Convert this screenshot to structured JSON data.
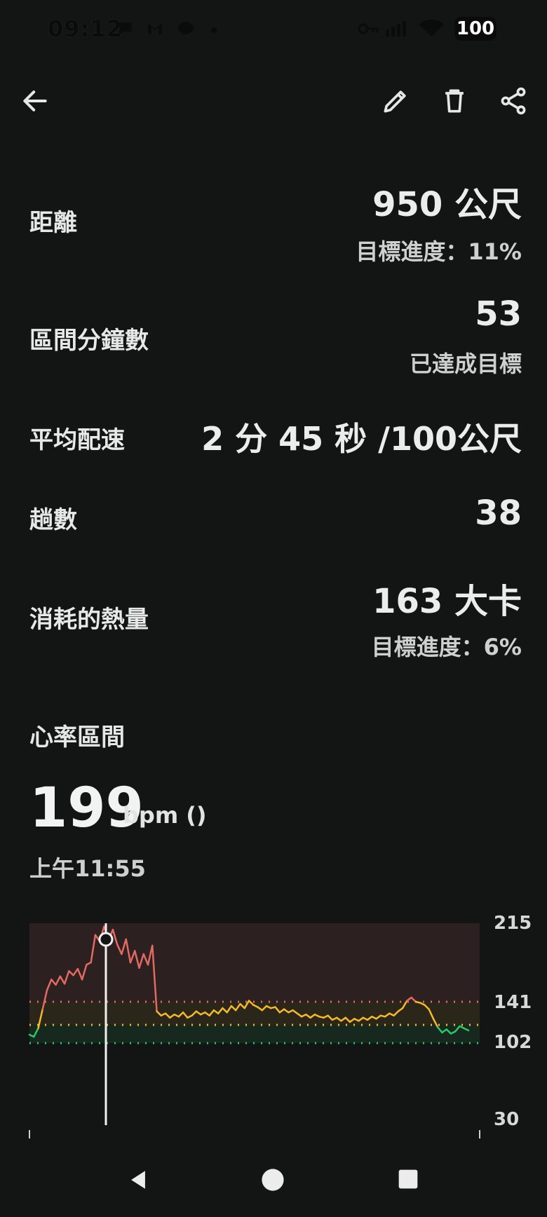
{
  "status_bar": {
    "time": "09:12",
    "battery": "100",
    "icons": [
      "chat-bubble-icon",
      "gmail-icon",
      "line-icon",
      "dot-icon",
      "vpn-key-icon",
      "signal-icon",
      "wifi-icon",
      "battery-icon"
    ]
  },
  "app_bar": {
    "icons": [
      "back-arrow-icon",
      "edit-icon",
      "delete-icon",
      "share-icon"
    ]
  },
  "stats": {
    "distance": {
      "label": "距離",
      "value": "950 公尺",
      "sub": "目標進度：11%"
    },
    "zone_minutes": {
      "label": "區間分鐘數",
      "value": "53",
      "sub": "已達成目標"
    },
    "avg_pace": {
      "label": "平均配速",
      "value": "2 分 45 秒 /100公尺"
    },
    "laps": {
      "label": "趟數",
      "value": "38"
    },
    "calories": {
      "label": "消耗的熱量",
      "value": "163 大卡",
      "sub": "目標進度：6%"
    }
  },
  "heart_rate": {
    "title": "心率區間",
    "value": "199",
    "unit": "bpm ()",
    "time": "上午11:55"
  },
  "chart_data": {
    "type": "line",
    "y_ticks": [
      "215",
      "141",
      "102",
      "30"
    ],
    "zone_lines": [
      141,
      118,
      102
    ],
    "ylim": [
      30,
      215
    ],
    "colors": {
      "peak": "#e36a62",
      "cardio": "#f5b92a",
      "fat_burn": "#29c96a"
    },
    "series": [
      {
        "x": [
          0,
          1,
          2,
          3,
          4,
          5,
          6,
          7,
          8,
          9,
          10,
          11,
          12,
          13,
          14,
          15,
          16,
          17,
          18,
          19,
          20,
          21,
          22,
          23,
          24,
          25,
          26,
          27,
          28,
          29,
          30,
          31,
          32,
          33,
          34,
          35,
          36,
          37,
          38,
          39,
          40,
          41,
          42,
          43,
          44,
          45,
          46,
          47,
          48,
          49,
          50,
          51,
          52,
          53,
          54,
          55,
          56,
          57,
          58,
          59,
          60,
          61,
          62,
          63,
          64,
          65,
          66,
          67,
          68,
          69,
          70,
          71,
          72,
          73,
          74,
          75,
          76,
          77,
          78,
          79,
          80,
          81,
          82,
          83,
          84,
          85,
          86,
          87,
          88,
          89,
          90,
          91,
          92,
          93,
          94,
          95,
          96,
          97,
          98,
          99,
          100
        ],
        "values": [
          110,
          108,
          116,
          134,
          152,
          162,
          157,
          165,
          158,
          170,
          166,
          172,
          162,
          176,
          178,
          204,
          198,
          212,
          199,
          209,
          195,
          186,
          200,
          178,
          189,
          173,
          186,
          176,
          194,
          132,
          128,
          130,
          126,
          129,
          127,
          131,
          126,
          128,
          132,
          129,
          131,
          128,
          133,
          130,
          135,
          131,
          137,
          133,
          139,
          135,
          142,
          138,
          136,
          133,
          137,
          135,
          136,
          131,
          134,
          131,
          133,
          130,
          127,
          129,
          126,
          129,
          127,
          126,
          128,
          124,
          126,
          123,
          126,
          122,
          125,
          123,
          126,
          124,
          127,
          125,
          128,
          127,
          130,
          128,
          132,
          135,
          142,
          145,
          141,
          140,
          138,
          134,
          125,
          117,
          112,
          115,
          111,
          113,
          118,
          116,
          114
        ]
      }
    ]
  },
  "nav_bar": {
    "icons": [
      "nav-back-icon",
      "nav-home-icon",
      "nav-recents-icon"
    ]
  }
}
